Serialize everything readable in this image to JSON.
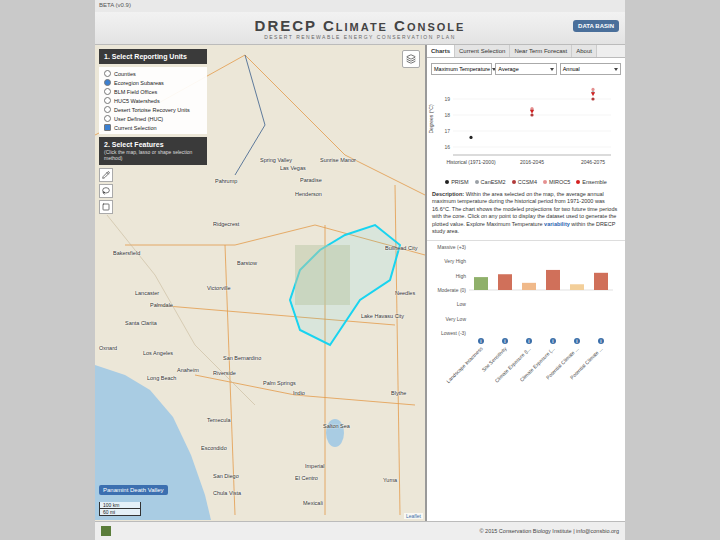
{
  "window": {
    "beta": "BETA (v0.9)",
    "title": "DRECP Climate Console",
    "subtitle": "DESERT RENEWABLE ENERGY CONSERVATION PLAN",
    "logo": "DATA BASIN"
  },
  "tabs": [
    {
      "label": "Charts",
      "selected": true
    },
    {
      "label": "Current Selection",
      "selected": false
    },
    {
      "label": "Near Term Forecast",
      "selected": false
    },
    {
      "label": "About",
      "selected": false
    }
  ],
  "left_panel": {
    "step1": "1. Select Reporting Units",
    "units": [
      {
        "label": "Counties",
        "selected": false
      },
      {
        "label": "Ecoregion Subareas",
        "selected": true
      },
      {
        "label": "BLM Field Offices",
        "selected": false
      },
      {
        "label": "HUC5 Watersheds",
        "selected": false
      },
      {
        "label": "Desert Tortoise Recovery Units",
        "selected": false
      },
      {
        "label": "User Defined (HUC)",
        "selected": false
      }
    ],
    "current_selection": {
      "label": "Current Selection",
      "checked": true
    },
    "step2": "2. Select Features",
    "step2_hint": "(Click the map, lasso or shape selection method)"
  },
  "map": {
    "selection_label": "Panamint Death Valley",
    "scale": [
      "100 km",
      "60 mi"
    ],
    "attribution": "Leaflet",
    "labels": [
      "Las Vegas",
      "Paradise",
      "Henderson",
      "Spring Valley",
      "Sunrise Manor",
      "Pahrump",
      "Ridgecrest",
      "Bakersfield",
      "Lancaster",
      "Palmdale",
      "Victorville",
      "Barstow",
      "Santa Clarita",
      "Oxnard",
      "Los Angeles",
      "Long Beach",
      "Anaheim",
      "Riverside",
      "San Bernardino",
      "Temecula",
      "Palm Springs",
      "Indio",
      "Salton Sea",
      "Escondido",
      "San Diego",
      "Chula Vista",
      "El Centro",
      "Imperial",
      "Mexicali",
      "Yuma",
      "Blythe",
      "Needles",
      "Lake Havasu City",
      "Bullhead City"
    ]
  },
  "controls": [
    "Maximum Temperature",
    "Average",
    "Annual"
  ],
  "scatter": {
    "axis_title": "Degrees (°C)",
    "ticks": [
      "16",
      "17",
      "18",
      "19"
    ],
    "periods": [
      "Historical (1971-2000)",
      "2016-2045",
      "2046-2075"
    ],
    "series": [
      {
        "name": "PRISM",
        "color": "#222222",
        "values": [
          16.6
        ]
      },
      {
        "name": "CanESM2",
        "color": "#9aa0a6",
        "values": [
          0,
          18.3,
          19.4
        ]
      },
      {
        "name": "CCSM4",
        "color": "#b03a3a",
        "values": [
          0,
          18.0,
          19.0
        ]
      },
      {
        "name": "MIROC5",
        "color": "#e59090",
        "values": [
          0,
          18.4,
          19.6
        ]
      },
      {
        "name": "Ensemble",
        "color": "#d42020",
        "values": [
          0,
          18.2,
          19.3
        ]
      }
    ]
  },
  "description": {
    "lead": "Description:",
    "body": "Within the area selected on the map, the average annual maximum temperature during the historical period from 1971-2000 was 16.6°C. The chart shows the modeled projections for two future time periods with the cone. Click on any point to display the dataset used to generate the plotted value. Explore Maximum Temperature",
    "link": "variability",
    "tail": "within the DRECP study area."
  },
  "bars": {
    "ticks": [
      "Massive (+3)",
      "Very High",
      "High",
      "Moderate (0)",
      "Low",
      "Very Low",
      "Lowest (-3)"
    ],
    "info_icon": "i",
    "items": [
      {
        "label": "Landscape Intactness",
        "level": 0.9,
        "color": "#8fb06a"
      },
      {
        "label": "Site Sensitivity",
        "level": 1.1,
        "color": "#d0705a"
      },
      {
        "label": "Climate Exposure (t...",
        "level": 0.5,
        "color": "#f0b98a"
      },
      {
        "label": "Climate Exposure (...",
        "level": 1.4,
        "color": "#d0705a"
      },
      {
        "label": "Potential Climate ...",
        "level": 0.4,
        "color": "#f3cf9a"
      },
      {
        "label": "Potential Climate ...",
        "level": 1.2,
        "color": "#d0705a"
      }
    ]
  },
  "footer": {
    "text": "© 2015 Conservation Biology Institute | info@consbio.org"
  }
}
